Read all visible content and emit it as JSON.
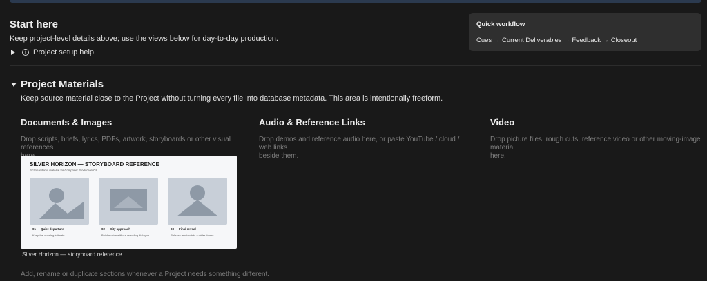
{
  "start": {
    "title": "Start here",
    "description": "Keep project-level details above; use the views below for day-to-day production.",
    "setup_toggle_label": "Project setup help"
  },
  "callout": {
    "title": "Quick workflow",
    "text": "Cues → Current Deliverables → Feedback → Closeout"
  },
  "materials": {
    "title": "Project Materials",
    "description": "Keep source material close to the Project without turning every file into database metadata. This area is intentionally freeform.",
    "columns": [
      {
        "title": "Documents & Images",
        "description_line1": "Drop scripts, briefs, lyrics, PDFs, artwork, storyboards or other visual references",
        "description_line2": "here."
      },
      {
        "title": "Audio & Reference Links",
        "description_line1": "Drop demos and reference audio here, or paste YouTube / cloud / web links",
        "description_line2": "beside them."
      },
      {
        "title": "Video",
        "description_line1": "Drop picture files, rough cuts, reference video or other moving-image material",
        "description_line2": "here."
      }
    ],
    "storyboard": {
      "title": "SILVER HORIZON — STORYBOARD REFERENCE",
      "subtitle": "Fictional demo material for Composer Production OS",
      "frames": [
        {
          "label": "01 — Quiet departure",
          "caption": "Keep the opening intimate."
        },
        {
          "label": "02 — City approach",
          "caption": "Build motion without crowding dialogue."
        },
        {
          "label": "03 — Final reveal",
          "caption": "Release tension into a wider theme."
        }
      ]
    },
    "image_caption": "Silver Horizon — storyboard reference",
    "footer_hint": "Add, rename or duplicate sections whenever a Project needs something different."
  },
  "colors": {
    "background": "#191919",
    "callout_bg": "#2f2f2f",
    "muted_text": "#7e7e7e"
  }
}
